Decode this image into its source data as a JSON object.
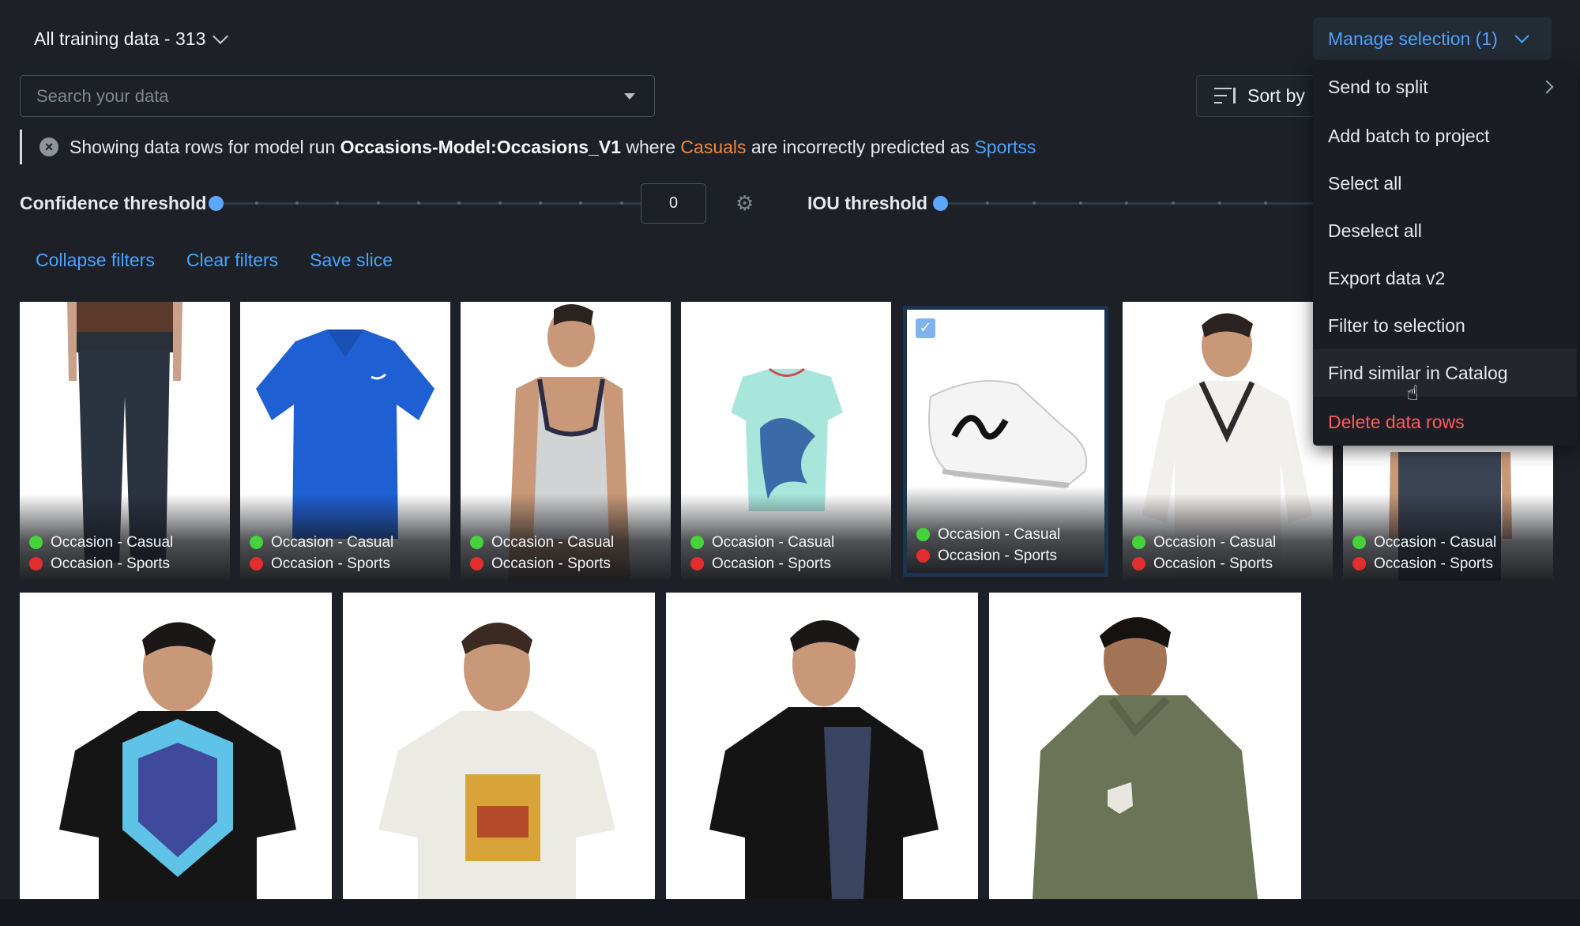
{
  "header": {
    "dataset_title": "All training data - 313"
  },
  "search": {
    "placeholder": "Search your data",
    "value": ""
  },
  "sort": {
    "label": "Sort by"
  },
  "filter_note": {
    "prefix": "Showing data rows for model run",
    "model_run": "Occasions-Model:Occasions_V1",
    "where": "where",
    "class_actual": "Casuals",
    "middle": "are incorrectly predicted as",
    "class_predicted": "Sportss"
  },
  "sliders": {
    "confidence_label": "Confidence threshold",
    "confidence_value": "0",
    "iou_label": "IOU threshold"
  },
  "filter_links": {
    "collapse": "Collapse filters",
    "clear": "Clear filters",
    "save": "Save slice"
  },
  "cards": [
    {
      "label1": "Occasion - Casual",
      "label2": "Occasion - Sports",
      "item": "jeans"
    },
    {
      "label1": "Occasion - Casual",
      "label2": "Occasion - Sports",
      "item": "polo"
    },
    {
      "label1": "Occasion - Casual",
      "label2": "Occasion - Sports",
      "item": "vest"
    },
    {
      "label1": "Occasion - Casual",
      "label2": "Occasion - Sports",
      "item": "tee"
    },
    {
      "label1": "Occasion - Casual",
      "label2": "Occasion - Sports",
      "item": "shoe",
      "selected": true
    },
    {
      "label1": "Occasion - Casual",
      "label2": "Occasion - Sports",
      "item": "vneck"
    },
    {
      "label1": "Occasion - Casual",
      "label2": "Occasion - Sports",
      "item": "tank"
    }
  ],
  "manage_selection": {
    "label": "Manage selection (1)",
    "items": [
      "Send to split",
      "Add batch to project",
      "Select all",
      "Deselect all",
      "Export data v2",
      "Filter to selection",
      "Find similar in Catalog",
      "Delete data rows"
    ]
  },
  "colors": {
    "accent": "#4aa3ff",
    "actual_class": "#f08a3a",
    "danger": "#ff5b5b",
    "correct_dot": "#45d23a",
    "wrong_dot": "#e42d2d"
  }
}
